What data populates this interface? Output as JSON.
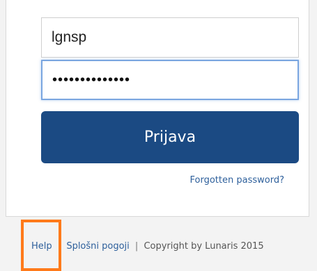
{
  "login": {
    "username_value": "lgnsp",
    "password_value": "••••••••••••••",
    "login_button": "Prijava",
    "forgot_password": "Forgotten password?"
  },
  "footer": {
    "help": "Help",
    "terms": "Splošni pogoji",
    "separator": "|",
    "copyright": "Copyright by Lunaris 2015"
  },
  "colors": {
    "primary": "#1b4a83",
    "link": "#2d5f9b",
    "highlight": "#ff7a1a"
  }
}
